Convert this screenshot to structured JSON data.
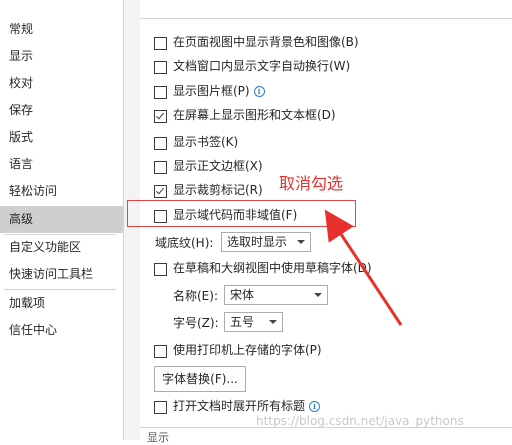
{
  "sidebar": {
    "items": [
      {
        "label": "常规"
      },
      {
        "label": "显示"
      },
      {
        "label": "校对"
      },
      {
        "label": "保存"
      },
      {
        "label": "版式"
      },
      {
        "label": "语言"
      },
      {
        "label": "轻松访问"
      },
      {
        "label": "高级",
        "selected": true
      },
      {
        "label": "自定义功能区"
      },
      {
        "label": "快速访问工具栏"
      },
      {
        "label": "加载项"
      },
      {
        "label": "信任中心"
      }
    ]
  },
  "options": {
    "show_background": {
      "label": "在页面视图中显示背景色和图像(B)",
      "checked": false
    },
    "wrap_text": {
      "label": "文档窗口内显示文字自动换行(W)",
      "checked": false
    },
    "picture_placeholders": {
      "label": "显示图片框(P)",
      "checked": false
    },
    "show_drawings": {
      "label": "在屏幕上显示图形和文本框(D)",
      "checked": true
    },
    "show_bookmarks": {
      "label": "显示书签(K)",
      "checked": false
    },
    "text_boundaries": {
      "label": "显示正文边框(X)",
      "checked": false
    },
    "crop_marks": {
      "label": "显示裁剪标记(R)",
      "checked": true
    },
    "field_codes": {
      "label": "显示域代码而非域值(F)",
      "checked": false
    },
    "draft_font": {
      "label": "在草稿和大纲视图中使用草稿字体(D)",
      "checked": false
    },
    "printer_fonts": {
      "label": "使用打印机上存储的字体(P)",
      "checked": false
    },
    "expand_headings": {
      "label": "打开文档时展开所有标题",
      "checked": false
    }
  },
  "field_shading": {
    "label": "域底纹(H):",
    "value": "选取时显示"
  },
  "font_name": {
    "label": "名称(E):",
    "value": "宋体"
  },
  "font_size": {
    "label": "字号(Z):",
    "value": "五号"
  },
  "font_substitution_button": "字体替换(F)...",
  "section_footer": "显示",
  "annotation": {
    "text": "取消勾选",
    "color": "#e8312d"
  },
  "watermark": "https://blog.csdn.net/java_pythons",
  "icons": {
    "info": "info-icon"
  }
}
